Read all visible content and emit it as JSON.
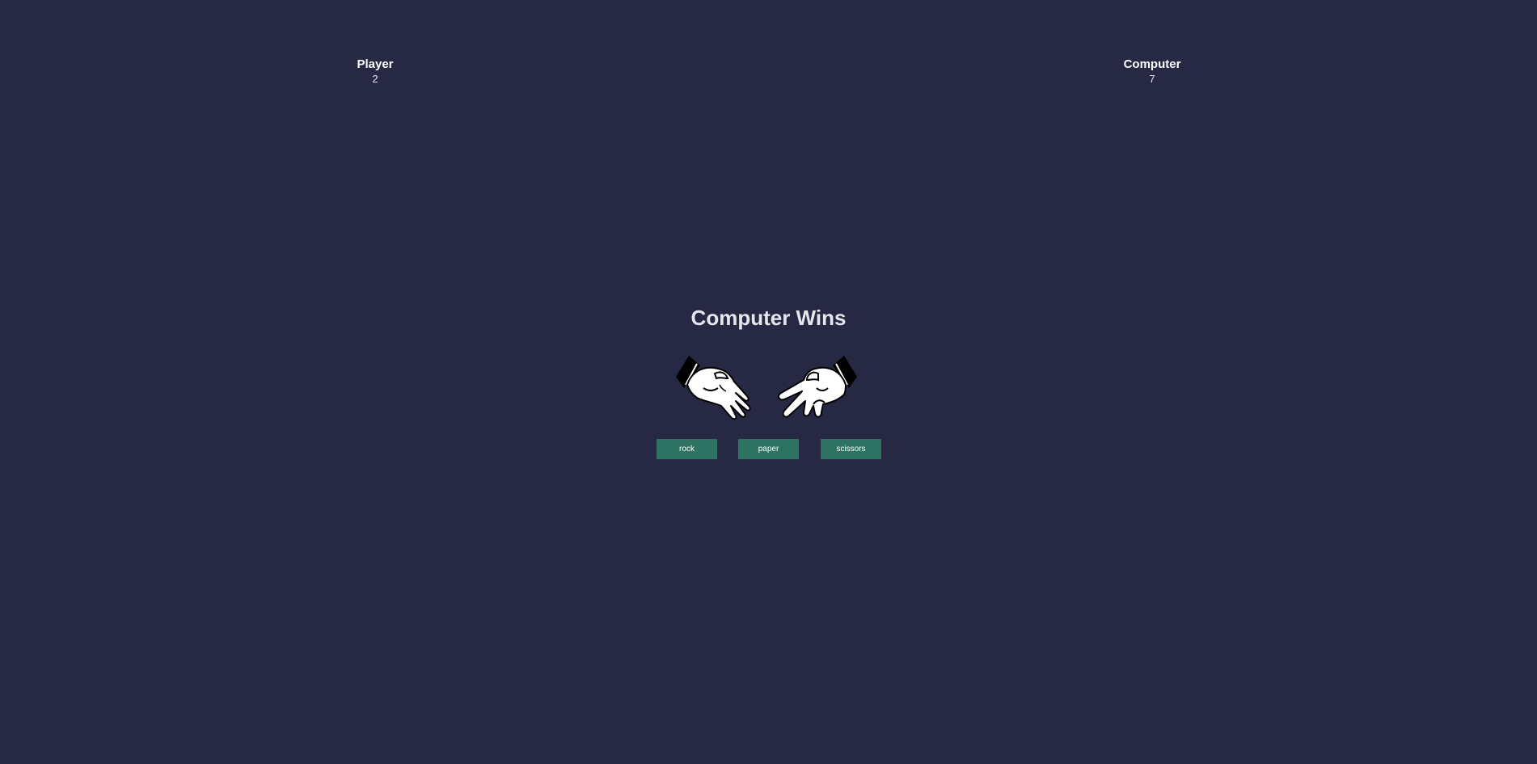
{
  "scoreboard": {
    "player": {
      "label": "Player",
      "score": "2"
    },
    "computer": {
      "label": "Computer",
      "score": "7"
    }
  },
  "result": {
    "text": "Computer Wins"
  },
  "hands": {
    "player_choice": "paper",
    "computer_choice": "scissors",
    "player_icon": "paper-hand-icon",
    "computer_icon": "scissors-hand-icon"
  },
  "controls": {
    "rock_label": "rock",
    "paper_label": "paper",
    "scissors_label": "scissors"
  },
  "colors": {
    "background": "#262844",
    "button": "#2e7262",
    "text": "#ffffff"
  }
}
